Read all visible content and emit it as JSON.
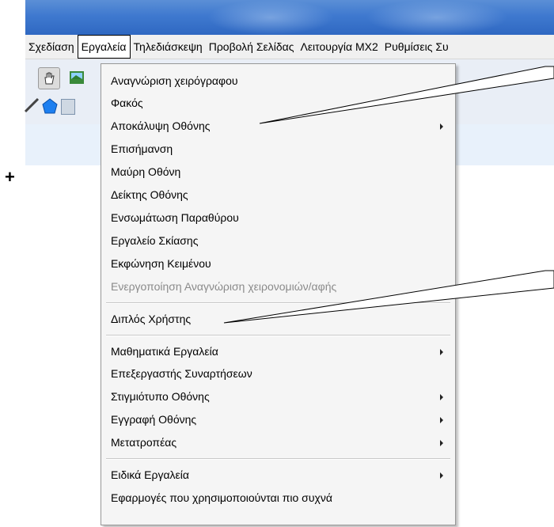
{
  "menubar": {
    "items": [
      {
        "label": "Σχεδίαση",
        "active": false
      },
      {
        "label": "Εργαλεία",
        "active": true
      },
      {
        "label": "Τηλεδιάσκεψη",
        "active": false
      },
      {
        "label": "Προβολή Σελίδας",
        "active": false
      },
      {
        "label": "Λειτουργία ΜΧ2",
        "active": false
      },
      {
        "label": "Ρυθμίσεις Συ",
        "active": false
      }
    ]
  },
  "crosshair": "+",
  "menu": {
    "items": [
      {
        "label": "Αναγνώριση χειρόγραφου",
        "submenu": false,
        "disabled": false
      },
      {
        "label": "Φακός",
        "submenu": false,
        "disabled": false
      },
      {
        "label": "Αποκάλυψη Οθόνης",
        "submenu": true,
        "disabled": false
      },
      {
        "label": "Επισήμανση",
        "submenu": false,
        "disabled": false
      },
      {
        "label": "Μαύρη Οθόνη",
        "submenu": false,
        "disabled": false
      },
      {
        "label": "Δείκτης Οθόνης",
        "submenu": false,
        "disabled": false
      },
      {
        "label": "Ενσωμάτωση Παραθύρου",
        "submenu": false,
        "disabled": false
      },
      {
        "label": "Εργαλείο Σκίασης",
        "submenu": false,
        "disabled": false
      },
      {
        "label": "Εκφώνηση Κειμένου",
        "submenu": false,
        "disabled": false
      },
      {
        "label": "Ενεργοποίηση Αναγνώριση χειρονομιών/αφής",
        "submenu": false,
        "disabled": true
      },
      {
        "label": "Διπλός Χρήστης",
        "submenu": false,
        "disabled": false
      },
      {
        "label": "Μαθηματικά Εργαλεία",
        "submenu": true,
        "disabled": false
      },
      {
        "label": "Επεξεργαστής Συναρτήσεων",
        "submenu": false,
        "disabled": false
      },
      {
        "label": "Στιγμιότυπο  Οθόνης",
        "submenu": true,
        "disabled": false
      },
      {
        "label": "Εγγραφή Οθόνης",
        "submenu": true,
        "disabled": false
      },
      {
        "label": "Μετατροπέας",
        "submenu": true,
        "disabled": false
      },
      {
        "label": "Ειδικά Εργαλεία",
        "submenu": true,
        "disabled": false
      },
      {
        "label": "Εφαρμογές που χρησιμοποιούνται πιο συχνά",
        "submenu": false,
        "disabled": false
      }
    ]
  },
  "colors": {
    "titlebar": "#3f79cf",
    "menubar_bg": "#f0f0f0",
    "menu_bg": "#f5f5f5",
    "disabled_text": "#8a8a8a",
    "toolbar_bg": "#e9eef6",
    "toolstrip_bg": "#e8f1fb"
  }
}
